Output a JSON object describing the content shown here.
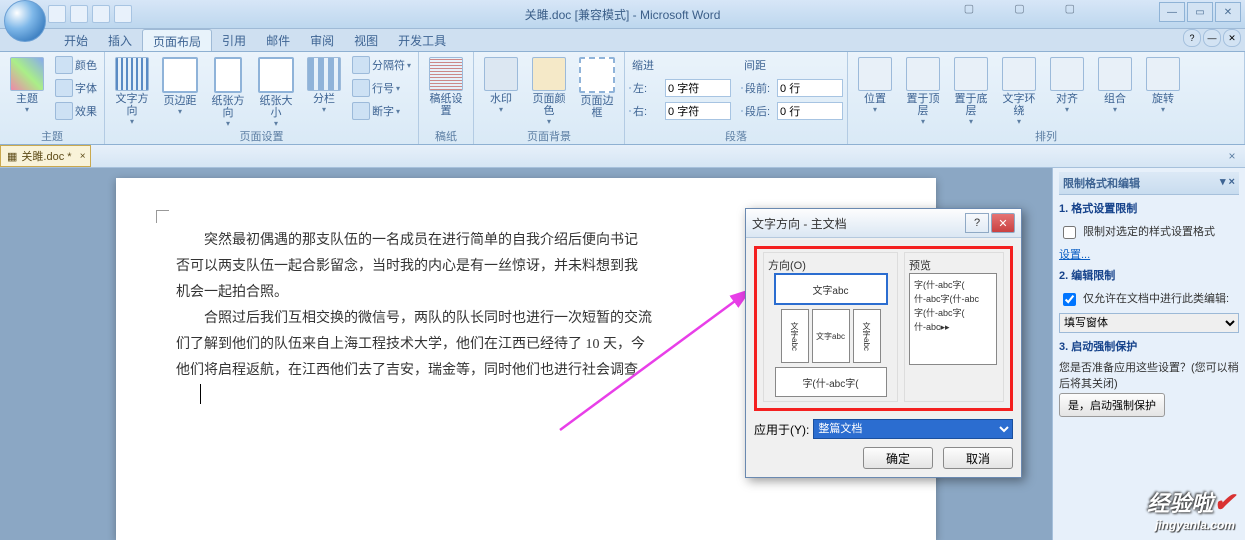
{
  "title": "关雎.doc [兼容模式] - Microsoft Word",
  "tabs": {
    "t0": "开始",
    "t1": "插入",
    "t2": "页面布局",
    "t3": "引用",
    "t4": "邮件",
    "t5": "审阅",
    "t6": "视图",
    "t7": "开发工具"
  },
  "groups": {
    "theme": "主题",
    "pagesetup": "页面设置",
    "gaozhi": "稿纸",
    "pagebg": "页面背景",
    "para": "段落",
    "arrange": "排列"
  },
  "btns": {
    "themes": "主题",
    "colors": "颜色",
    "fonts": "字体",
    "effects": "效果",
    "textdir": "文字方向",
    "margins": "页边距",
    "orient": "纸张方向",
    "size": "纸张大小",
    "columns": "分栏",
    "breaks": "分隔符",
    "linenum": "行号",
    "hyphen": "断字",
    "gaoset": "稿纸设置",
    "watermark": "水印",
    "pgcolor": "页面颜色",
    "border": "页面边框",
    "indent": "缩进",
    "left": "左:",
    "right": "右:",
    "spacing": "间距",
    "before": "段前:",
    "after": "段后:",
    "position": "位置",
    "front": "置于顶层",
    "back": "置于底层",
    "wrap": "文字环绕",
    "align": "对齐",
    "group": "组合",
    "rotate": "旋转"
  },
  "vals": {
    "left": "0 字符",
    "right": "0 字符",
    "before": "0 行",
    "after": "0 行"
  },
  "doctab": "关雎.doc *",
  "para1": "突然最初偶遇的那支队伍的一名成员在进行简单的自我介绍后便向书记",
  "para1b": "否可以两支队伍一起合影留念，当时我的内心是有一丝惊讶，并未料想到我",
  "para1c": "机会一起拍合照。",
  "para2": "合照过后我们互相交换的微信号，两队的队长同时也进行一次短暂的交流",
  "para2b": "们了解到他们的队伍来自上海工程技术大学，他们在江西已经待了 10 天，今",
  "para2c": "他们将启程返航，在江西他们去了吉安，瑞金等，同时他们也进行社会调查",
  "dialog": {
    "title": "文字方向 - 主文档",
    "orient": "方向(O)",
    "preview": "预览",
    "sample": "文字abc",
    "sample2": "文字abc",
    "sample3": "字(什-abc字(",
    "sample4": "什-abc字(什-abc",
    "sample5": "字(什-abc字(",
    "sample6": "什-abc▸▸",
    "applyto": "应用于(Y):",
    "applyval": "整篇文档",
    "ok": "确定",
    "cancel": "取消"
  },
  "sidepane": {
    "title": "限制格式和编辑",
    "sec1": "1. 格式设置限制",
    "chk1": "限制对选定的样式设置格式",
    "set": "设置...",
    "sec2": "2. 编辑限制",
    "chk2": "仅允许在文档中进行此类编辑:",
    "opt": "填写窗体",
    "sec3": "3. 启动强制保护",
    "msg": "您是否准备应用这些设置？(您可以稍后将其关闭)",
    "btn": "是，启动强制保护"
  },
  "watermark": {
    "t1": "经验啦",
    "t2": "jingyanla.com"
  }
}
